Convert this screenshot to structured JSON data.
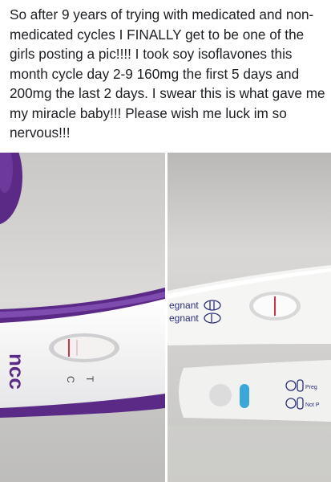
{
  "post": {
    "text": "So after 9 years of trying with medicated and non-medicated cycles I FINALLY get to be one of the girls posting a pic!!!! I took soy isoflavones this month cycle day 2-9 160mg the first 5 days and 200mg the last 2 days. I swear this is what gave me my miracle baby!!! Please wish me luck im so nervous!!!"
  },
  "photos": {
    "left": {
      "brand_partial": "ncc",
      "label_c": "C",
      "label_t": "T"
    },
    "right": {
      "line1_partial": "egnant",
      "line2_partial": "egnant",
      "key1_partial": "Preg",
      "key2_partial": "Not P"
    }
  },
  "colors": {
    "purple": "#5b2a86",
    "result_line": "#d0324a",
    "blue_window": "#3aa7d8"
  }
}
